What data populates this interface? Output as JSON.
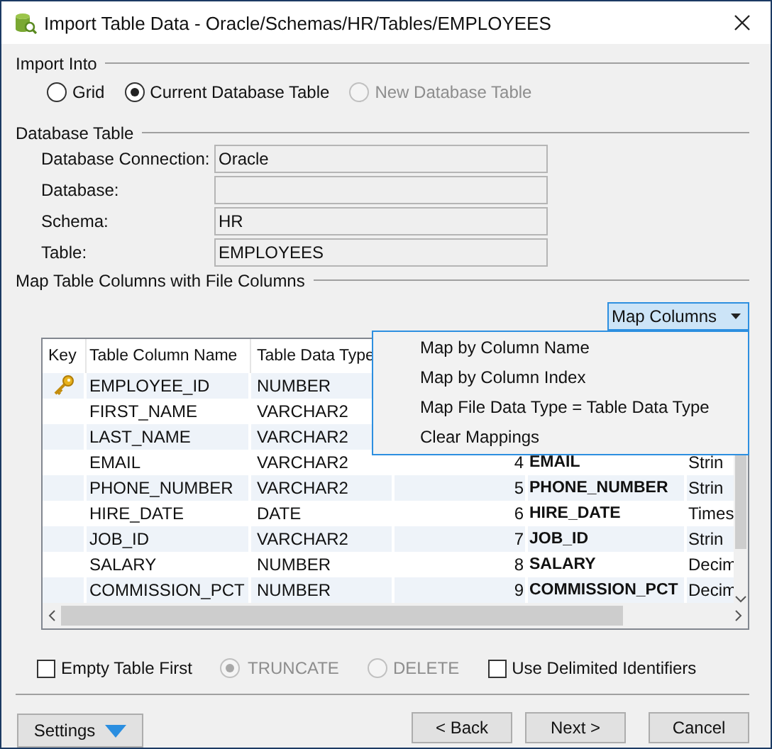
{
  "window": {
    "title": "Import Table Data - Oracle/Schemas/HR/Tables/EMPLOYEES"
  },
  "import_into": {
    "heading": "Import Into",
    "options": [
      {
        "label": "Grid",
        "selected": false,
        "disabled": false
      },
      {
        "label": "Current Database Table",
        "selected": true,
        "disabled": false
      },
      {
        "label": "New Database Table",
        "selected": false,
        "disabled": true
      }
    ]
  },
  "database_table": {
    "heading": "Database Table",
    "fields": [
      {
        "label": "Database Connection:",
        "value": "Oracle"
      },
      {
        "label": "Database:"
      },
      {
        "label": "Schema:",
        "value": "HR"
      },
      {
        "label": "Table:",
        "value": "EMPLOYEES"
      }
    ]
  },
  "mapping": {
    "heading": "Map Table Columns with File Columns",
    "map_button": "Map Columns",
    "menu": [
      "Map by Column Name",
      "Map by Column Index",
      "Map File Data Type = Table Data Type",
      "Clear Mappings"
    ],
    "columns": [
      "Key",
      "Table Column Name",
      "Table Data Type"
    ],
    "rows": [
      {
        "primary_key": true,
        "name": "EMPLOYEE_ID",
        "type": "NUMBER"
      },
      {
        "primary_key": false,
        "name": "FIRST_NAME",
        "type": "VARCHAR2"
      },
      {
        "primary_key": false,
        "name": "LAST_NAME",
        "type": "VARCHAR2"
      },
      {
        "primary_key": false,
        "name": "EMAIL",
        "type": "VARCHAR2",
        "column_4": "4",
        "column_5": "EMAIL",
        "column_6": "Strin"
      },
      {
        "primary_key": false,
        "name": "PHONE_NUMBER",
        "type": "VARCHAR2",
        "column_4": "5",
        "column_5": "PHONE_NUMBER",
        "column_6": "Strin"
      },
      {
        "primary_key": false,
        "name": "HIRE_DATE",
        "type": "DATE",
        "column_4": "6",
        "column_5": "HIRE_DATE",
        "column_6": "Times"
      },
      {
        "primary_key": false,
        "name": "JOB_ID",
        "type": "VARCHAR2",
        "column_4": "7",
        "column_5": "JOB_ID",
        "column_6": "Strin"
      },
      {
        "primary_key": false,
        "name": "SALARY",
        "type": "NUMBER",
        "column_4": "8",
        "column_5": "SALARY",
        "column_6": "Decim"
      },
      {
        "primary_key": false,
        "name": "COMMISSION_PCT",
        "type": "NUMBER",
        "column_4": "9",
        "column_5": "COMMISSION_PCT",
        "column_6": "Decim"
      }
    ]
  },
  "options": [
    {
      "kind": "checkbox",
      "label": "Empty Table First",
      "checked": false,
      "disabled": false
    },
    {
      "kind": "radio",
      "label": "TRUNCATE",
      "selected": true,
      "disabled": true
    },
    {
      "kind": "radio",
      "label": "DELETE",
      "selected": false,
      "disabled": true
    },
    {
      "kind": "checkbox",
      "label": "Use Delimited Identifiers",
      "checked": false,
      "disabled": false
    }
  ],
  "buttons": {
    "settings": "Settings",
    "back": "< Back",
    "next": "Next >",
    "cancel": "Cancel"
  }
}
